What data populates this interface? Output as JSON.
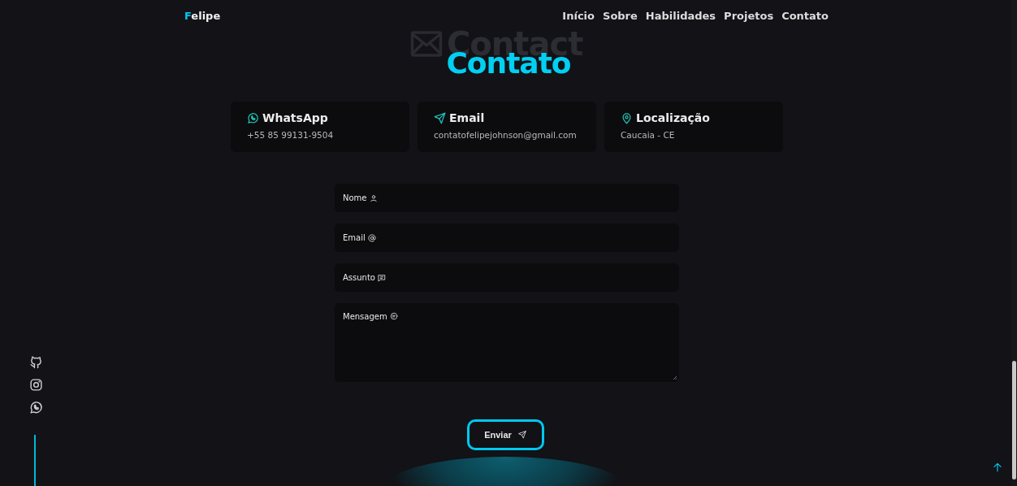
{
  "nav": {
    "logo_initial": "F",
    "logo_rest": "elipe",
    "links": [
      {
        "label": "Início"
      },
      {
        "label": "Sobre"
      },
      {
        "label": "Habilidades"
      },
      {
        "label": "Projetos"
      },
      {
        "label": "Contato"
      }
    ]
  },
  "section": {
    "background_title": "Contact",
    "title": "Contato"
  },
  "cards": [
    {
      "kind": "whatsapp",
      "title": "WhatsApp",
      "value": "+55 85 99131-9504"
    },
    {
      "kind": "email",
      "title": "Email",
      "value": "contatofelipejohnson@gmail.com"
    },
    {
      "kind": "location",
      "title": "Localização",
      "value": "Caucaia - CE"
    }
  ],
  "form": {
    "fields": [
      {
        "kind": "user",
        "label": "Nome"
      },
      {
        "kind": "at",
        "label": "Email"
      },
      {
        "kind": "subject",
        "label": "Assunto"
      },
      {
        "kind": "message",
        "label": "Mensagem"
      }
    ],
    "submit": "Enviar"
  },
  "social": [
    {
      "kind": "github"
    },
    {
      "kind": "instagram"
    },
    {
      "kind": "whatsapp"
    }
  ]
}
